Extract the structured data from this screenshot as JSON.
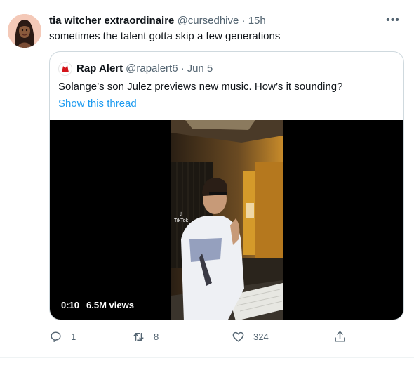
{
  "tweet": {
    "display_name": "tia witcher extraordinaire",
    "handle": "@cursedhive",
    "separator": "·",
    "time": "15h",
    "text": "sometimes the talent gotta skip a few generations",
    "more_icon": "more-icon"
  },
  "quoted_tweet": {
    "display_name": "Rap Alert",
    "handle": "@rapalert6",
    "separator": "·",
    "date": "Jun 5",
    "text": "Solange’s son Julez previews new music. How’s it sounding?",
    "thread_link": "Show this thread",
    "avatar_icon": "rap-alert-logo",
    "video": {
      "elapsed": "0:10",
      "views": "6.5M views",
      "watermark": "TikTok"
    }
  },
  "actions": {
    "reply_count": "1",
    "retweet_count": "8",
    "like_count": "324",
    "icons": [
      "reply-icon",
      "retweet-icon",
      "like-icon",
      "share-icon"
    ]
  },
  "colors": {
    "accent": "#1d9bf0",
    "secondary_text": "#536471",
    "border": "#cfd9de",
    "video_background": "#000000"
  }
}
